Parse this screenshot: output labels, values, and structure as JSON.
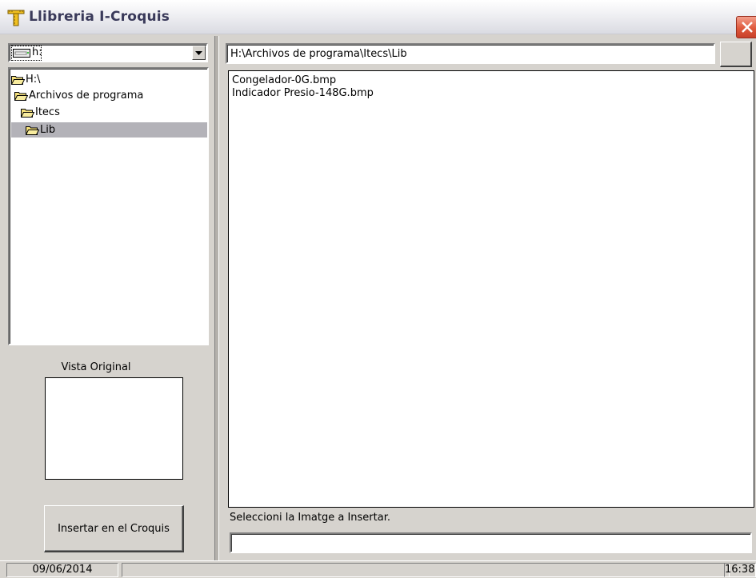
{
  "window": {
    "title": "Llibreria I-Croquis"
  },
  "left_panel": {
    "drive_combo": {
      "selected": "h:"
    },
    "folder_tree": [
      {
        "label": "H:\\",
        "indent": 0,
        "selected": false
      },
      {
        "label": "Archivos de programa",
        "indent": 1,
        "selected": false
      },
      {
        "label": "Itecs",
        "indent": 2,
        "selected": false
      },
      {
        "label": "Lib",
        "indent": 3,
        "selected": true
      }
    ],
    "preview_label": "Vista Original",
    "insert_button_label": "Insertar en el Croquis"
  },
  "right_panel": {
    "path": "H:\\Archivos de programa\\Itecs\\Lib",
    "files": [
      "Congelador-0G.bmp",
      "Indicador Presio-148G.bmp"
    ],
    "hint": "Seleccioni la Imatge a Insertar.",
    "bottom_input_value": ""
  },
  "statusbar": {
    "date": "09/06/2014",
    "time": "16:38"
  },
  "colors": {
    "window_bg": "#d6d3ce",
    "selection": "#b3b2b8",
    "close_button": "#df5a3d"
  }
}
